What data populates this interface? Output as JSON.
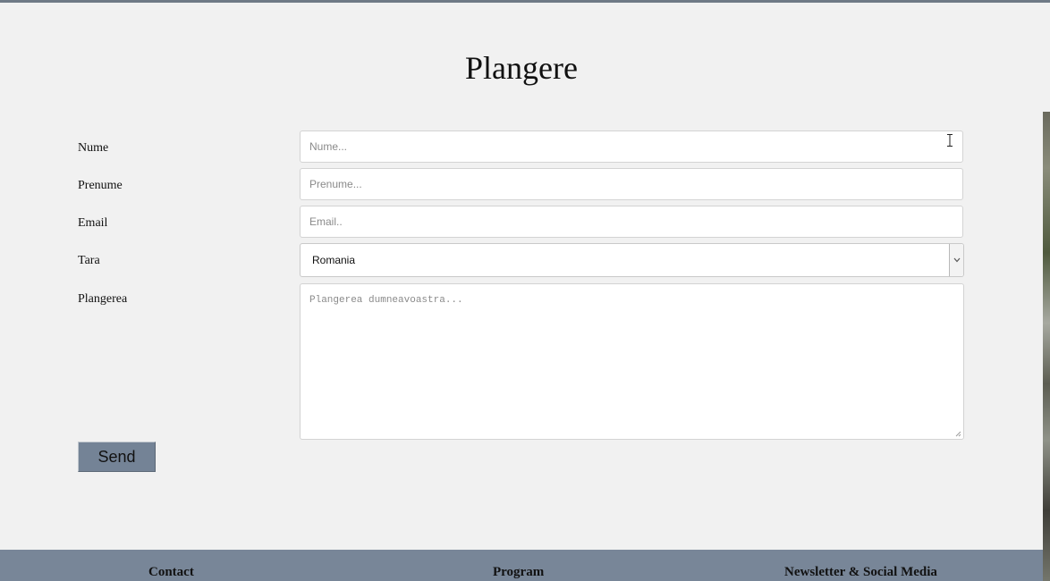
{
  "page": {
    "title": "Plangere"
  },
  "form": {
    "nume": {
      "label": "Nume",
      "placeholder": "Nume..."
    },
    "prenume": {
      "label": "Prenume",
      "placeholder": "Prenume..."
    },
    "email": {
      "label": "Email",
      "placeholder": "Email.."
    },
    "tara": {
      "label": "Tara",
      "selected": "Romania"
    },
    "plangerea": {
      "label": "Plangerea",
      "placeholder": "Plangerea dumneavoastra..."
    },
    "send_label": "Send"
  },
  "footer": {
    "headings": [
      "Contact",
      "Program",
      "Newsletter & Social Media"
    ]
  },
  "colors": {
    "page_background": "#f1f1f1",
    "footer_background": "#788698",
    "button_background": "#748396"
  }
}
